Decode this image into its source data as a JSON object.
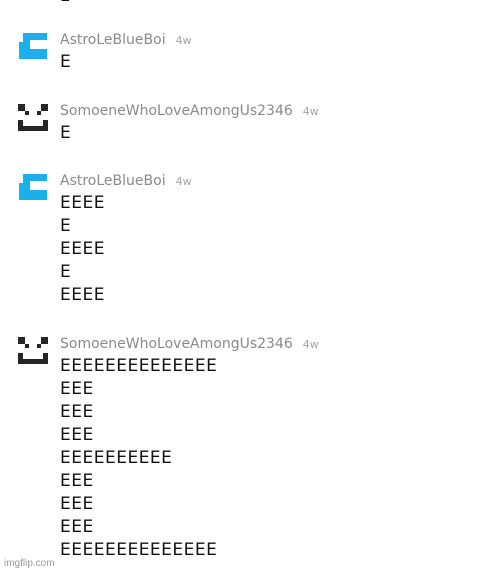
{
  "top_fragment": "E",
  "comments": [
    {
      "username": "AstroLeBlueBoi",
      "age": "4w",
      "avatar": "blue-c-icon",
      "lines": [
        "E"
      ]
    },
    {
      "username": "SomoeneWhoLoveAmongUs2346",
      "age": "4w",
      "avatar": "pixel-face-icon",
      "lines": [
        "E"
      ]
    },
    {
      "username": "AstroLeBlueBoi",
      "age": "4w",
      "avatar": "blue-c-icon",
      "lines": [
        "EEEE",
        "E",
        "EEEE",
        "E",
        "EEEE"
      ]
    },
    {
      "username": "SomoeneWhoLoveAmongUs2346",
      "age": "4w",
      "avatar": "pixel-face-icon",
      "lines": [
        "EEEEEEEEEEEEEE",
        "EEE",
        "EEE",
        "EEE",
        "EEEEEEEEEE",
        "EEE",
        "EEE",
        "EEE",
        "EEEEEEEEEEEEEE"
      ]
    }
  ],
  "watermark": "imgflip.com",
  "colors": {
    "blue_avatar": "#1ab0ec",
    "dark_avatar": "#262626",
    "username": "#8a8a8a"
  }
}
